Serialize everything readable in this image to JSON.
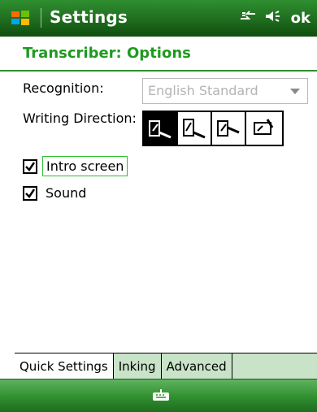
{
  "top": {
    "title": "Settings",
    "ok_label": "ok"
  },
  "header": {
    "title": "Transcriber: Options"
  },
  "fields": {
    "recognition_label": "Recognition:",
    "recognition_value": "English Standard",
    "writing_direction_label": "Writing Direction:"
  },
  "options": {
    "intro_label": "Intro screen",
    "sound_label": "Sound"
  },
  "tabs": [
    {
      "label": "Quick Settings"
    },
    {
      "label": "Inking"
    },
    {
      "label": "Advanced"
    }
  ],
  "colors": {
    "accent_green": "#1f9a1f",
    "focus_green": "#2fbf2f",
    "tab_bg": "#c8e3c8"
  }
}
